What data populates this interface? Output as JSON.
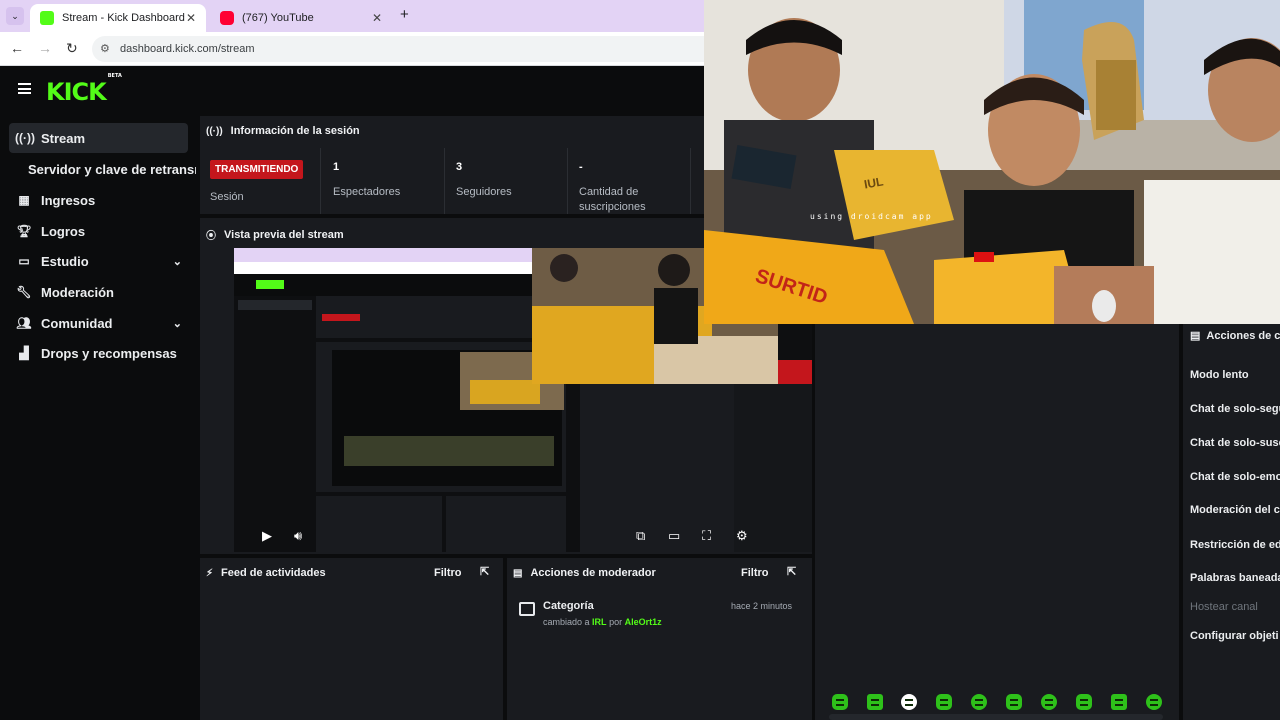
{
  "browser": {
    "tabs": [
      {
        "title": "Stream - Kick Dashboard",
        "favicon": "kick-icon",
        "color": "#53fc18"
      },
      {
        "title": "(767) YouTube",
        "favicon": "youtube-icon",
        "color": "#ff0033"
      }
    ],
    "new_tab": "+",
    "url": "dashboard.kick.com/stream"
  },
  "brand": {
    "logo": "KICK",
    "beta": "BETA",
    "accent": "#53fc18"
  },
  "sidebar": {
    "items": [
      {
        "label": "Stream",
        "icon": "broadcast-icon"
      },
      {
        "label": "Servidor y clave de retransmisión"
      },
      {
        "label": "Ingresos",
        "icon": "chart-icon"
      },
      {
        "label": "Logros",
        "icon": "trophy-icon"
      },
      {
        "label": "Estudio",
        "icon": "studio-icon"
      },
      {
        "label": "Moderación",
        "icon": "wrench-icon"
      },
      {
        "label": "Comunidad",
        "icon": "community-icon"
      },
      {
        "label": "Drops y recompensas",
        "icon": "drops-icon"
      }
    ]
  },
  "session": {
    "title": "Información de la sesión",
    "status_badge": "TRANSMITIENDO",
    "status_label": "Sesión",
    "stats": [
      {
        "value": "1",
        "label": "Espectadores"
      },
      {
        "value": "3",
        "label": "Seguidores"
      },
      {
        "value": "-",
        "label": "Cantidad de suscripciones"
      }
    ]
  },
  "preview": {
    "title": "Vista previa del stream"
  },
  "activity": {
    "title": "Feed de actividades",
    "filter": "Filtro"
  },
  "mod_actions": {
    "title": "Acciones de moderador",
    "filter": "Filtro",
    "entry": {
      "title": "Categoría",
      "prefix": "cambiado a",
      "category": "IRL",
      "by": "por",
      "user": "AleOrt1z",
      "time": "hace 2 minutos"
    }
  },
  "chat_actions": {
    "title": "Acciones de c",
    "items": [
      {
        "label": "Modo lento"
      },
      {
        "label": "Chat de solo-segu"
      },
      {
        "label": "Chat de solo-susc"
      },
      {
        "label": "Chat de solo-emo"
      },
      {
        "label": "Moderación del c"
      },
      {
        "label": "Restricción de ed"
      },
      {
        "label": "Palabras baneada"
      },
      {
        "label": "Hostear canal",
        "disabled": true
      },
      {
        "label": "Configurar objeti"
      }
    ]
  },
  "webcam": {
    "watermark": "using droidcam app",
    "box_text": "SURTID",
    "bag_text": "IUL"
  }
}
